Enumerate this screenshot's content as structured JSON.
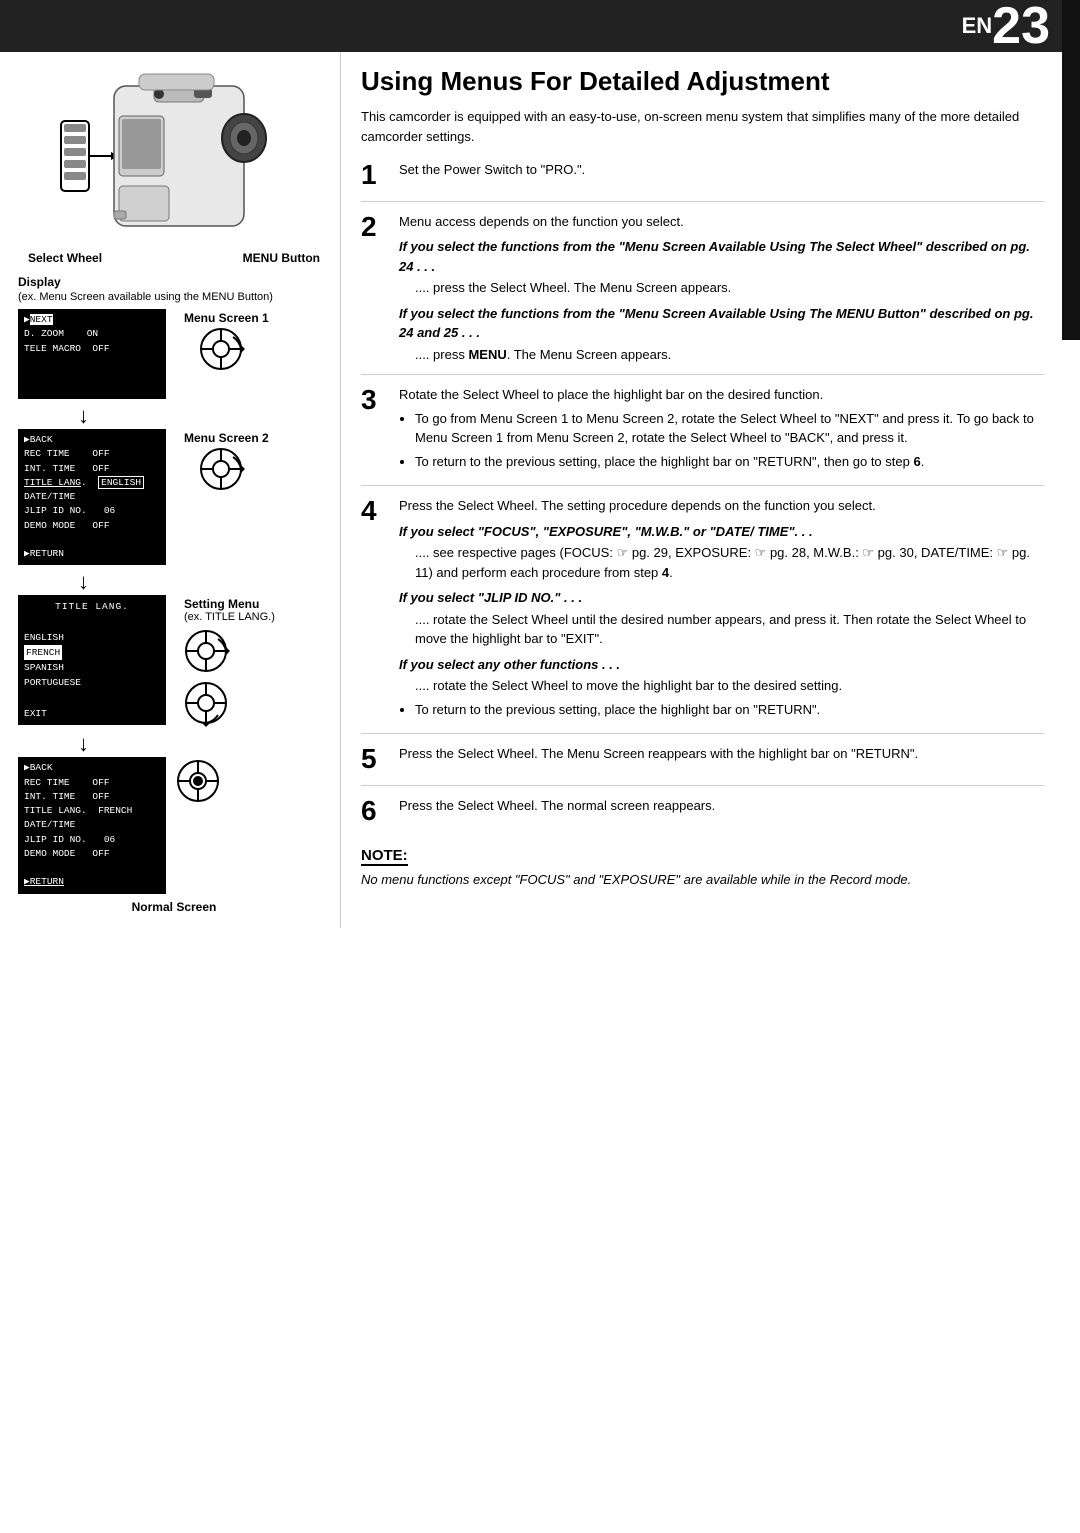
{
  "header": {
    "en_label": "EN",
    "page_number": "23"
  },
  "left_col": {
    "camcorder": {
      "select_wheel_label": "Select Wheel",
      "menu_button_label": "MENU Button"
    },
    "display_label": "Display",
    "display_sublabel": "(ex. Menu Screen available using the MENU Button)",
    "menu_screen_1_label": "Menu Screen 1",
    "menu_screen_1_lines": [
      "▶NEXT",
      "D. ZOOM    ON",
      "TELE MACRO   OFF"
    ],
    "menu_screen_2_label": "Menu Screen 2",
    "menu_screen_2_lines": [
      "▶BACK",
      "REC TIME    OFF",
      "INT. TIME   OFF",
      "TITLE LANG.  ENGLISH",
      "DATE/TIME",
      "JLIP ID NO.   06",
      "DEMO MODE    OFF",
      "",
      "▶RETURN"
    ],
    "setting_menu_label": "Setting Menu",
    "setting_menu_sublabel": "(ex. TITLE LANG.)",
    "setting_menu_lines": [
      "  TITLE LANG.",
      "",
      "ENGLISH",
      "FRENCH",
      "SPANISH",
      "PORTUGUESE",
      "",
      "EXIT"
    ],
    "normal_screen_menu_lines": [
      "▶BACK",
      "REC TIME    OFF",
      "INT. TIME   OFF",
      "TITLE LANG.  FRENCH",
      "DATE/TIME",
      "JLIP ID NO.   06",
      "DEMO MODE    OFF",
      "",
      "▶RETURN"
    ],
    "normal_screen_label": "Normal Screen"
  },
  "right_col": {
    "title": "Using Menus For Detailed Adjustment",
    "intro": "This camcorder is equipped with an easy-to-use, on-screen menu system that simplifies many of the more detailed camcorder settings.",
    "steps": [
      {
        "number": "1",
        "text": "Set the Power Switch to \"PRO.\"."
      },
      {
        "number": "2",
        "text": "Menu access depends on the function you select.",
        "bold_italic_1": "If you select the functions from the \"Menu Screen Available Using The Select Wheel\" described on pg. 24 . . .",
        "sub1": ".... press the Select Wheel. The Menu Screen appears.",
        "bold_italic_2": "If you select the functions from the \"Menu Screen Available Using The MENU Button\" described on pg. 24 and 25 . . .",
        "sub2": ".... press MENU. The Menu Screen appears."
      },
      {
        "number": "3",
        "text": "Rotate the Select Wheel to place the highlight bar on the desired function.",
        "bullets": [
          "To go from Menu Screen 1 to Menu Screen 2, rotate the Select Wheel to \"NEXT\" and press it. To go back to Menu Screen 1 from Menu Screen 2, rotate the Select Wheel to \"BACK\", and press it.",
          "To return to the previous setting, place the highlight bar on \"RETURN\", then go to step 6."
        ]
      },
      {
        "number": "4",
        "text": "Press the Select Wheel. The setting procedure depends on the function you select.",
        "focus_label": "If you select \"FOCUS\", \"EXPOSURE\", \"M.W.B.\" or \"DATE/ TIME\". . .",
        "focus_text": ".... see respective pages (FOCUS: ☞ pg. 29, EXPOSURE: ☞ pg. 28, M.W.B.: ☞ pg. 30, DATE/TIME: ☞ pg. 11) and perform each procedure from step 4.",
        "jlip_label": "If you select \"JLIP ID NO.\" . . .",
        "jlip_text": ".... rotate the Select Wheel until the desired number appears, and press it. Then rotate the Select Wheel to move the highlight bar to \"EXIT\".",
        "other_label": "If you select any other functions . . .",
        "other_text": ".... rotate the Select Wheel to move the highlight bar to the desired setting.",
        "other_bullet": "To return to the previous setting, place the highlight bar on \"RETURN\"."
      },
      {
        "number": "5",
        "text": "Press the Select Wheel. The Menu Screen reappears with the highlight bar on \"RETURN\"."
      },
      {
        "number": "6",
        "text": "Press the Select Wheel. The normal screen reappears."
      }
    ],
    "note": {
      "title": "NOTE:",
      "text": "No menu functions except \"FOCUS\" and \"EXPOSURE\" are available while in the Record mode."
    }
  }
}
